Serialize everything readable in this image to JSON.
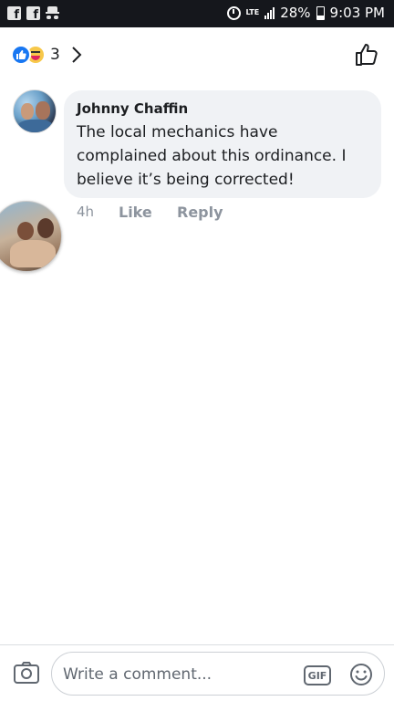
{
  "status_bar": {
    "left_icons": [
      "facebook-notification-icon",
      "facebook-notification-icon",
      "incognito-icon"
    ],
    "network": "LTE",
    "battery": "28%",
    "time": "9:03 PM"
  },
  "reactions": {
    "types": [
      "like-reaction-icon",
      "haha-reaction-icon"
    ],
    "count": "3"
  },
  "comment": {
    "author": "Johnny Chaffin",
    "text": "The local mechanics have complained about this ordinance. I believe it’s being corrected!",
    "time": "4h",
    "like_label": "Like",
    "reply_label": "Reply"
  },
  "composer": {
    "placeholder": "Write a comment...",
    "gif_label": "GIF"
  },
  "colors": {
    "status_bar": "#15171c",
    "like_blue": "#1877f2",
    "bubble_bg": "#f0f2f5",
    "meta_gray": "#8d949e"
  }
}
